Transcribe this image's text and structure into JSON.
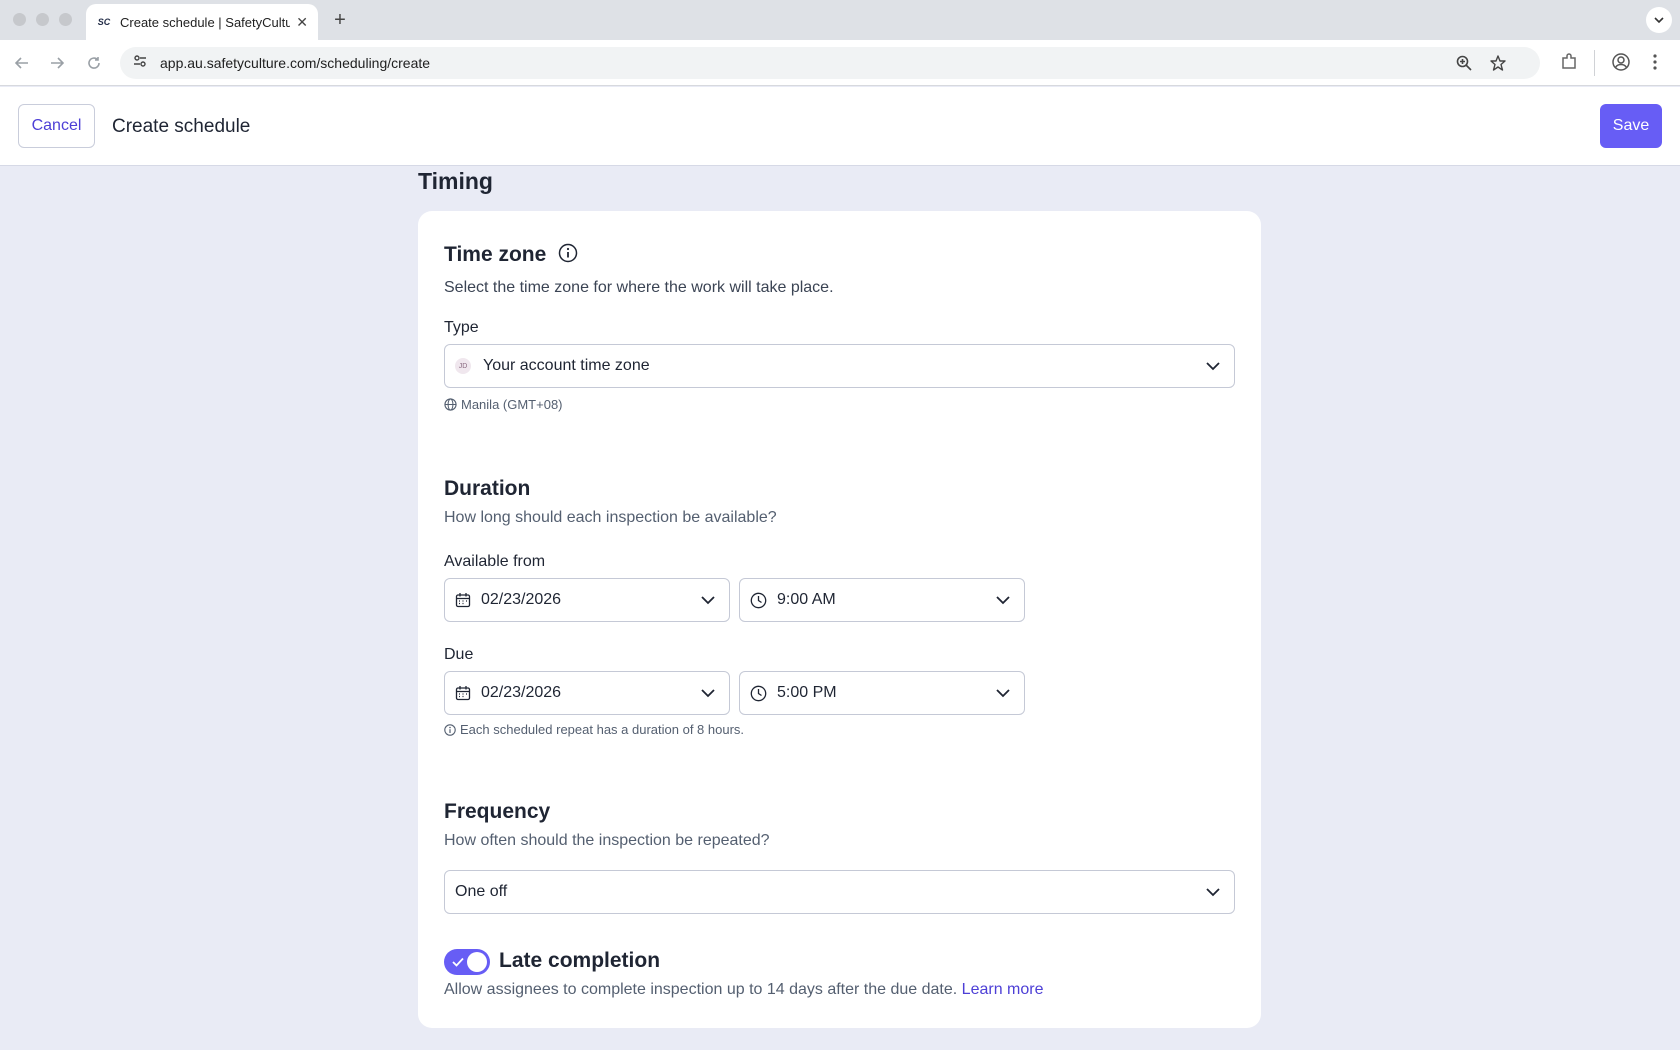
{
  "browser": {
    "tab_title": "Create schedule | SafetyCulture",
    "favicon_text": "SC",
    "url": "app.au.safetyculture.com/scheduling/create"
  },
  "header": {
    "cancel_label": "Cancel",
    "title": "Create schedule",
    "save_label": "Save"
  },
  "timing": {
    "section_title": "Timing",
    "time_zone": {
      "title": "Time zone",
      "description": "Select the time zone for where the work will take place.",
      "type_label": "Type",
      "avatar_initials": "JD",
      "type_value": "Your account time zone",
      "zone_note": "Manila (GMT+08)"
    },
    "duration": {
      "title": "Duration",
      "description": "How long should each inspection be available?",
      "available_from_label": "Available from",
      "available_from_date": "02/23/2026",
      "available_from_time": "9:00 AM",
      "due_label": "Due",
      "due_date": "02/23/2026",
      "due_time": "5:00 PM",
      "duration_note": "Each scheduled repeat has a duration of 8 hours."
    },
    "frequency": {
      "title": "Frequency",
      "description": "How often should the inspection be repeated?",
      "value": "One off"
    },
    "late_completion": {
      "title": "Late completion",
      "enabled": true,
      "description": "Allow assignees to complete inspection up to 14 days after the due date.",
      "link_label": "Learn more"
    }
  },
  "colors": {
    "accent": "#675df5",
    "link": "#4d3fd6",
    "page_background": "#e9ebf5"
  }
}
